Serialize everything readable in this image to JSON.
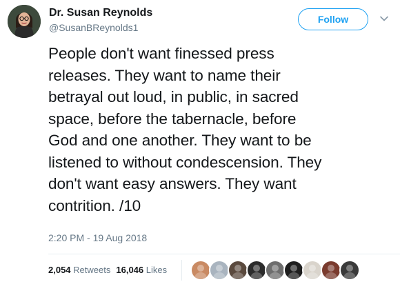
{
  "author": {
    "name": "Dr. Susan Reynolds",
    "handle": "@SusanBReynolds1"
  },
  "follow_button": {
    "label": "Follow"
  },
  "tweet": {
    "lines": [
      "People don't want finessed press",
      "releases. They want to name their",
      "betrayal out loud, in public, in sacred",
      "space, before the tabernacle, before",
      "God and one another. They want to be",
      "listened to without condescension. They",
      "don't want easy answers. They want",
      "contrition. /10"
    ],
    "timestamp": "2:20 PM - 19 Aug 2018"
  },
  "stats": {
    "retweets_count": "2,054",
    "retweets_label": "Retweets",
    "likes_count": "16,046",
    "likes_label": "Likes"
  },
  "liker_avatars": [
    {
      "color": "#c98a63"
    },
    {
      "color": "#a9b4bf"
    },
    {
      "color": "#5b4a3e"
    },
    {
      "color": "#2b2b2b"
    },
    {
      "color": "#6e6e6e"
    },
    {
      "color": "#1e1e1e"
    },
    {
      "color": "#d9d4cc"
    },
    {
      "color": "#7a3b2e"
    },
    {
      "color": "#3a3a3a"
    }
  ],
  "colors": {
    "accent": "#1da1f2",
    "text": "#14171a",
    "muted": "#657786",
    "divider": "#e6ecf0"
  }
}
